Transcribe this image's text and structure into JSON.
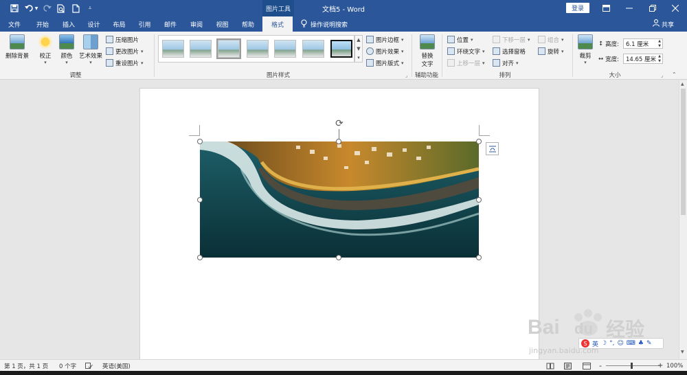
{
  "app": {
    "context_tab_group": "图片工具",
    "doc_title": "文档5 - Word",
    "login_label": "登录",
    "share_label": "共享",
    "tell_me": "操作说明搜索"
  },
  "tabs": [
    "文件",
    "开始",
    "插入",
    "设计",
    "布局",
    "引用",
    "邮件",
    "审阅",
    "视图",
    "帮助",
    "格式"
  ],
  "active_tab": "格式",
  "ribbon": {
    "adjust": {
      "group_label": "调整",
      "remove_bg": "删除背景",
      "corrections": "校正",
      "color": "颜色",
      "artistic": "艺术效果",
      "compress": "压缩图片",
      "change": "更改图片",
      "reset": "重设图片"
    },
    "styles": {
      "group_label": "图片样式",
      "border": "图片边框",
      "effects": "图片效果",
      "layout": "图片版式"
    },
    "accessibility": {
      "group_label": "辅助功能",
      "alt_text_line1": "替换",
      "alt_text_line2": "文字"
    },
    "arrange": {
      "group_label": "排列",
      "position": "位置",
      "wrap": "环绕文字",
      "forward": "上移一层",
      "backward": "下移一层",
      "selection_pane": "选择窗格",
      "align": "对齐",
      "group": "组合",
      "rotate": "旋转"
    },
    "size": {
      "group_label": "大小",
      "crop": "裁剪",
      "height_label": "高度:",
      "height_value": "6.1 厘米",
      "width_label": "宽度:",
      "width_value": "14.65 厘米"
    }
  },
  "statusbar": {
    "page": "第 1 页，共 1 页",
    "words": "0 个字",
    "language": "英语(美国)",
    "zoom": "100%",
    "zoom_minus": "-",
    "zoom_plus": "+"
  },
  "watermark": {
    "text_cn": "经验",
    "text_en": "Bai",
    "text_du": "du",
    "url": "jingyan.baidu.com"
  },
  "ime": {
    "lang": "英"
  },
  "colors": {
    "word_blue": "#2b579a",
    "ribbon_bg": "#f3f3f3",
    "canvas_bg": "#e6e6e6"
  },
  "icons": [
    "save-icon",
    "undo-icon",
    "redo-icon",
    "print-preview-icon",
    "new-doc-icon",
    "customize-qat-icon",
    "ribbon-display-icon",
    "minimize-icon",
    "restore-icon",
    "close-icon",
    "lightbulb-icon",
    "person-icon",
    "rotate-icon",
    "layout-options-icon"
  ]
}
